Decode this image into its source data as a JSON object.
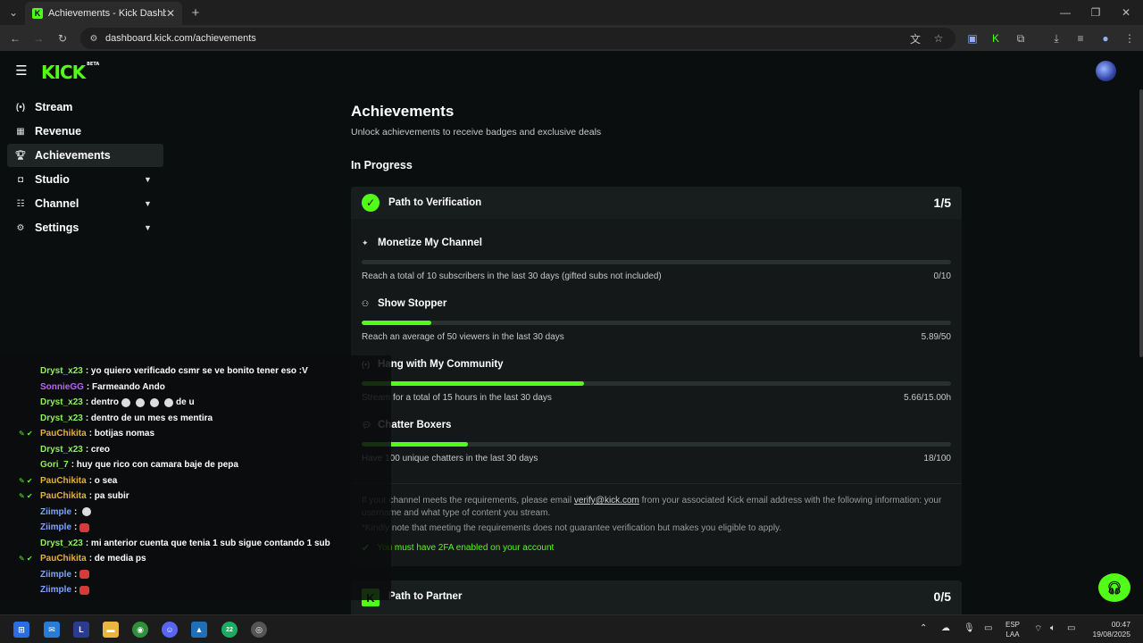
{
  "browser": {
    "tab_title": "Achievements - Kick Dashboard",
    "tab_favicon": "K",
    "url": "dashboard.kick.com/achievements"
  },
  "kick": {
    "logo": "KICK",
    "logo_tag": "BETA",
    "accent": "#53fc18"
  },
  "sidebar": {
    "items": [
      {
        "label": "Stream",
        "icon": "broadcast-icon"
      },
      {
        "label": "Revenue",
        "icon": "revenue-icon"
      },
      {
        "label": "Achievements",
        "icon": "trophy-icon",
        "active": true
      },
      {
        "label": "Studio",
        "icon": "studio-icon",
        "expandable": true
      },
      {
        "label": "Channel",
        "icon": "channel-icon",
        "expandable": true
      },
      {
        "label": "Settings",
        "icon": "gear-icon",
        "expandable": true
      }
    ]
  },
  "main": {
    "title": "Achievements",
    "subtitle": "Unlock achievements to receive badges and exclusive deals",
    "section": "In Progress",
    "verification": {
      "title": "Path to Verification",
      "count": "1/5",
      "achievements": [
        {
          "title": "Monetize My Channel",
          "desc": "Reach a total of 10 subscribers in the last 30 days (gifted subs not included)",
          "value": "0/10",
          "progress": 0
        },
        {
          "title": "Show Stopper",
          "desc": "Reach an average of 50 viewers in the last 30 days",
          "value": "5.89/50",
          "progress": 0.118
        },
        {
          "title": "Hang with My Community",
          "desc": "Stream for a total of 15 hours in the last 30 days",
          "value": "5.66/15.00h",
          "progress": 0.377
        },
        {
          "title": "Chatter Boxers",
          "desc": "Have 100 unique chatters in the last 30 days",
          "value": "18/100",
          "progress": 0.18
        }
      ],
      "info_prefix": "If your channel meets the requirements, please email ",
      "info_email": "verify@kick.com",
      "info_suffix": " from your associated Kick email address with the following information: your username and what type of content you stream.",
      "info_note": "*Kindly note that meeting the requirements does not guarantee verification but makes you eligible to apply.",
      "info_2fa": "You must have 2FA enabled on your account"
    },
    "partner": {
      "title": "Path to Partner",
      "count": "0/5"
    }
  },
  "chat": {
    "lines": [
      {
        "user": "Dryst_x23",
        "color": "#8ef05a",
        "text": ": yo quiero verificado csmr se ve bonito tener eso :V"
      },
      {
        "user": "SonnieGG",
        "color": "#b765f5",
        "text": ": Farmeando Ando"
      },
      {
        "user": "Dryst_x23",
        "color": "#8ef05a",
        "text": ": dentro",
        "emotes": 4,
        "tail": "de u"
      },
      {
        "user": "Dryst_x23",
        "color": "#8ef05a",
        "text": ": dentro de un mes es mentira"
      },
      {
        "user": "PauChikita",
        "color": "#e2b33c",
        "text": ": botijas nomas",
        "badges": true
      },
      {
        "user": "Dryst_x23",
        "color": "#8ef05a",
        "text": ": creo"
      },
      {
        "user": "Gori_7",
        "color": "#8ef05a",
        "text": ": huy que rico con camara baje de pepa"
      },
      {
        "user": "PauChikita",
        "color": "#e2b33c",
        "text": ": o sea",
        "badges": true
      },
      {
        "user": "PauChikita",
        "color": "#e2b33c",
        "text": ": pa subir",
        "badges": true
      },
      {
        "user": "Ziimple",
        "color": "#7fa4ff",
        "text": ":",
        "white_emote": true
      },
      {
        "user": "Ziimple",
        "color": "#7fa4ff",
        "text": ":",
        "red_emote": true
      },
      {
        "user": "Dryst_x23",
        "color": "#8ef05a",
        "text": ": mi anterior cuenta que tenia 1 sub sigue contando 1 sub"
      },
      {
        "user": "PauChikita",
        "color": "#e2b33c",
        "text": ": de media ps",
        "badges": true
      },
      {
        "user": "Ziimple",
        "color": "#7fa4ff",
        "text": ":",
        "red_emote": true
      },
      {
        "user": "Ziimple",
        "color": "#7fa4ff",
        "text": ":",
        "red_emote": true
      }
    ]
  },
  "taskbar": {
    "lang_1": "ESP",
    "lang_2": "LAA",
    "time": "00:47",
    "date": "19/08/2025",
    "chat_badge": "22"
  }
}
